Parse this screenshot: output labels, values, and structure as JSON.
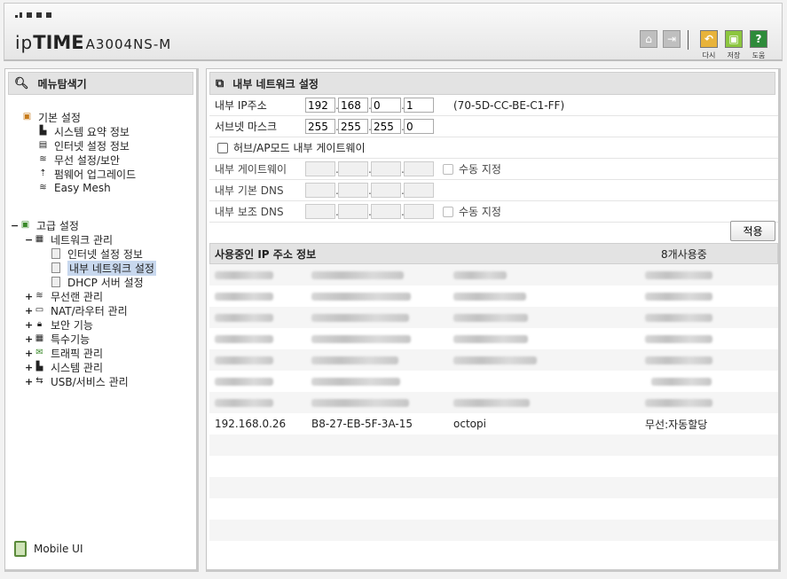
{
  "header": {
    "brand_prefix": "ip",
    "brand_bold": "TIME",
    "model": "A3004NS-M",
    "buttons": {
      "home": "home-icon",
      "logout": "logout-icon",
      "refresh_label": "다시",
      "save_label": "저장",
      "help_label": "도움"
    },
    "colors": {
      "refresh": "#e8b33a",
      "save": "#8cc63f",
      "help": "#2e8b3a"
    }
  },
  "sidebar": {
    "title": "메뉴탐색기",
    "basic_group": "기본 설정",
    "basic_items": [
      "시스템 요약 정보",
      "인터넷 설정 정보",
      "무선 설정/보안",
      "펌웨어 업그레이드",
      "Easy Mesh"
    ],
    "advanced_group": "고급 설정",
    "network_group": "네트워크 관리",
    "network_items": [
      "인터넷 설정 정보",
      "내부 네트워크 설정",
      "DHCP 서버 설정"
    ],
    "advanced_items": [
      "무선랜 관리",
      "NAT/라우터 관리",
      "보안 기능",
      "특수기능",
      "트래픽 관리",
      "시스템 관리",
      "USB/서비스 관리"
    ],
    "mobile_label": "Mobile UI"
  },
  "main": {
    "title": "내부 네트워크 설정",
    "ip_label": "내부 IP주소",
    "ip": [
      "192",
      "168",
      "0",
      "1"
    ],
    "mac": "(70-5D-CC-BE-C1-FF)",
    "subnet_label": "서브넷 마스크",
    "subnet": [
      "255",
      "255",
      "255",
      "0"
    ],
    "hub_ap_label": "허브/AP모드 내부 게이트웨이",
    "gateway_label": "내부 게이트웨이",
    "manual_label": "수동 지정",
    "dns1_label": "내부 기본 DNS",
    "dns2_label": "내부 보조 DNS",
    "apply_label": "적용",
    "table_title": "사용중인 IP 주소 정보",
    "table_count": "8개사용중",
    "visible_row": {
      "ip": "192.168.0.26",
      "mac": "B8-27-EB-5F-3A-15",
      "name": "octopi",
      "type": "무선:자동할당"
    }
  }
}
